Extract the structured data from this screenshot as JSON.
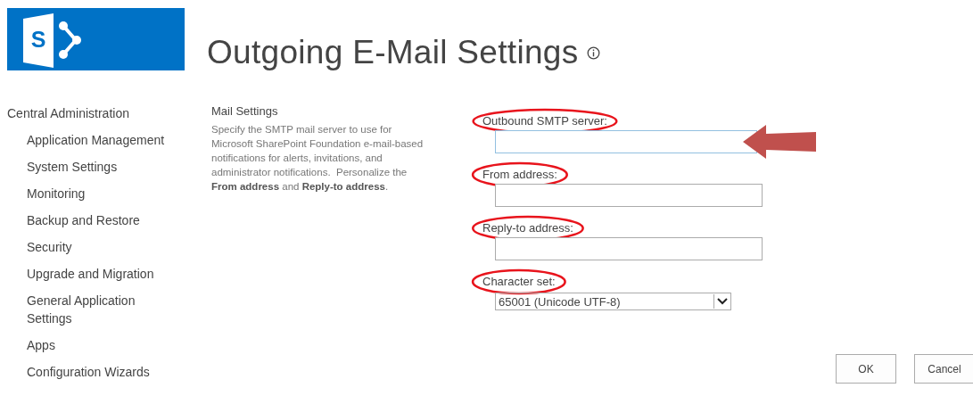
{
  "logo": {
    "letter": "S"
  },
  "page": {
    "title": "Outgoing E-Mail Settings"
  },
  "nav": {
    "heading": "Central Administration",
    "items": [
      {
        "label": "Application Management"
      },
      {
        "label": "System Settings"
      },
      {
        "label": "Monitoring"
      },
      {
        "label": "Backup and Restore"
      },
      {
        "label": "Security"
      },
      {
        "label": "Upgrade and Migration"
      },
      {
        "label": "General Application Settings"
      },
      {
        "label": "Apps"
      },
      {
        "label": "Configuration Wizards"
      }
    ]
  },
  "section": {
    "title": "Mail Settings",
    "description": "Specify the SMTP mail server to use for Microsoft SharePoint Foundation e-mail-based notifications for alerts, invitations, and administrator notifications.  Personalize the **From address** and **Reply-to address**."
  },
  "fields": [
    {
      "kind": "text",
      "label": "Outbound SMTP server:",
      "focused": true,
      "circled": true,
      "arrow": true
    },
    {
      "kind": "text",
      "label": "From address:",
      "focused": false,
      "circled": true,
      "arrow": false
    },
    {
      "kind": "text",
      "label": "Reply-to address:",
      "focused": false,
      "circled": true,
      "arrow": false
    },
    {
      "kind": "select",
      "label": "Character set:",
      "value": "65001 (Unicode UTF-8)",
      "circled": true,
      "arrow": false
    }
  ],
  "buttons": [
    {
      "label": "OK"
    },
    {
      "label": "Cancel"
    }
  ]
}
